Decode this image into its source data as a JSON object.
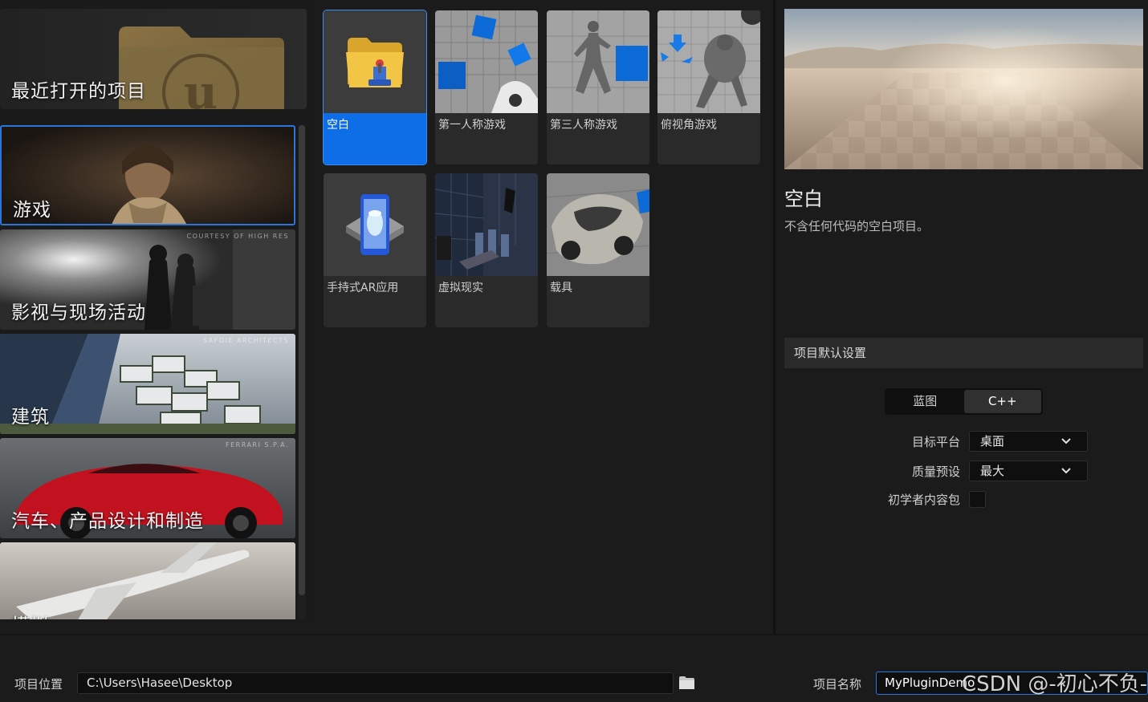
{
  "recent": {
    "label": "最近打开的项目"
  },
  "categories": [
    {
      "label": "游戏",
      "credit": ""
    },
    {
      "label": "影视与现场活动",
      "credit": "COURTESY OF HIGH RES"
    },
    {
      "label": "建筑",
      "credit": "SAFDIE ARCHITECTS"
    },
    {
      "label": "汽车、产品设计和制造",
      "credit": "FERRARI S.P.A."
    },
    {
      "label": "模拟",
      "credit": ""
    }
  ],
  "templates": [
    {
      "label": "空白",
      "icon": "folder-controller-icon"
    },
    {
      "label": "第一人称游戏",
      "icon": "first-person-icon"
    },
    {
      "label": "第三人称游戏",
      "icon": "third-person-icon"
    },
    {
      "label": "俯视角游戏",
      "icon": "top-down-icon"
    },
    {
      "label": "手持式AR应用",
      "icon": "handheld-ar-icon"
    },
    {
      "label": "虚拟现实",
      "icon": "vr-icon"
    },
    {
      "label": "载具",
      "icon": "vehicle-icon"
    }
  ],
  "detail": {
    "title": "空白",
    "description": "不含任何代码的空白项目。"
  },
  "defaults": {
    "header": "项目默认设置",
    "segments": [
      "蓝图",
      "C++"
    ],
    "active_segment": "蓝图",
    "target_platform_label": "目标平台",
    "target_platform_value": "桌面",
    "quality_label": "质量预设",
    "quality_value": "最大",
    "starter_content_label": "初学者内容包",
    "starter_content_checked": false
  },
  "bottom": {
    "location_label": "项目位置",
    "location_value": "C:\\Users\\Hasee\\Desktop",
    "name_label": "项目名称",
    "name_value": "MyPluginDemo"
  },
  "watermark": "CSDN @-初心不负-",
  "colors": {
    "accent": "#0e6ee8",
    "background": "#1b1b1b",
    "card": "#2a2a2a"
  }
}
